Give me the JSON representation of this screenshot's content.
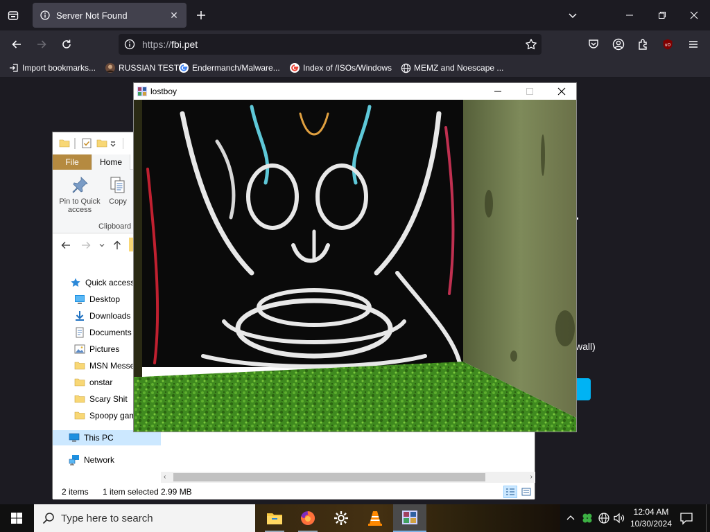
{
  "browser": {
    "tab_title": "Server Not Found",
    "url_dim": "https://",
    "url_host": "fbi.pet",
    "bookmarks": [
      {
        "label": "Import bookmarks...",
        "icon": "import-icon"
      },
      {
        "label": "RUSSIAN TEST",
        "icon": "site-favicon"
      },
      {
        "label": "Endermanch/Malware...",
        "icon": "google-icon"
      },
      {
        "label": "Index of /ISOs/Windows",
        "icon": "google-icon"
      },
      {
        "label": "MEMZ and Noescape ...",
        "icon": "globe-icon"
      }
    ],
    "partial_text": "wall)"
  },
  "explorer": {
    "ribbon_tabs": {
      "file": "File",
      "home": "Home"
    },
    "ribbon": {
      "pin_label_1": "Pin to Quick",
      "pin_label_2": "access",
      "copy_label": "Copy",
      "group_label": "Clipboard"
    },
    "nav": [
      {
        "label": "Quick access",
        "icon": "star-icon"
      },
      {
        "label": "Desktop",
        "icon": "desktop-icon"
      },
      {
        "label": "Downloads",
        "icon": "download-icon"
      },
      {
        "label": "Documents",
        "icon": "documents-icon"
      },
      {
        "label": "Pictures",
        "icon": "pictures-icon"
      },
      {
        "label": "MSN Messe",
        "icon": "folder-icon"
      },
      {
        "label": "onstar",
        "icon": "folder-icon"
      },
      {
        "label": "Scary Shit",
        "icon": "folder-icon"
      },
      {
        "label": "Spoopy gam",
        "icon": "folder-icon"
      },
      {
        "label": "This PC",
        "icon": "computer-icon"
      },
      {
        "label": "Network",
        "icon": "network-icon"
      }
    ],
    "status": {
      "items": "2 items",
      "selected": "1 item selected",
      "size": "2.99 MB"
    }
  },
  "lostboy": {
    "title": "lostboy"
  },
  "taskbar": {
    "search_placeholder": "Type here to search",
    "time": "12:04 AM",
    "date": "10/30/2024"
  },
  "colors": {
    "accent": "#00b3f4",
    "file_tab": "#b58a40"
  }
}
